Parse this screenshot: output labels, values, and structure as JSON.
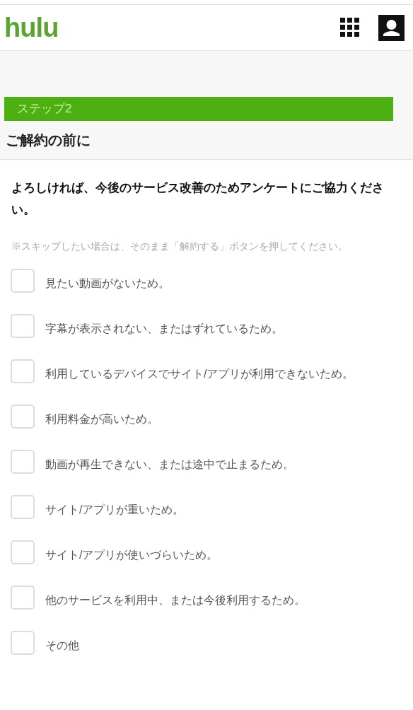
{
  "header": {
    "logo": "hulu"
  },
  "step": {
    "label": "ステップ2"
  },
  "title": "ご解約の前に",
  "intro": "よろしければ、今後のサービス改善のためアンケートにご協力ください。",
  "note": "※スキップしたい場合は、そのまま「解約する」ボタンを押してください。",
  "reasons": [
    {
      "label": "見たい動画がないため。",
      "checked": false
    },
    {
      "label": "字幕が表示されない、またはずれているため。",
      "checked": false
    },
    {
      "label": "利用しているデバイスでサイト/アプリが利用できないため。",
      "checked": false
    },
    {
      "label": "利用料金が高いため。",
      "checked": false
    },
    {
      "label": "動画が再生できない、または途中で止まるため。",
      "checked": false
    },
    {
      "label": "サイト/アプリが重いため。",
      "checked": false
    },
    {
      "label": "サイト/アプリが使いづらいため。",
      "checked": false
    },
    {
      "label": "他のサービスを利用中、または今後利用するため。",
      "checked": false
    },
    {
      "label": "その他",
      "checked": false
    }
  ]
}
